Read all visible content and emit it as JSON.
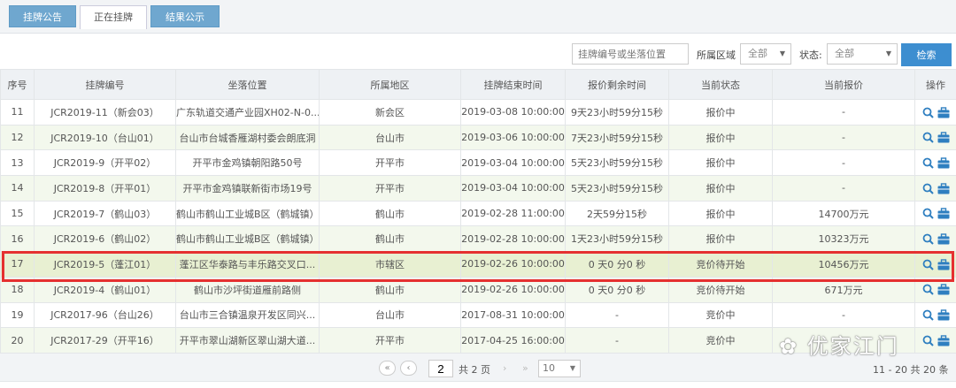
{
  "tabs": [
    "挂牌公告",
    "正在挂牌",
    "结果公示"
  ],
  "toolbar": {
    "search_placeholder": "挂牌编号或坐落位置",
    "region_label": "所属区域",
    "region_value": "全部",
    "status_label": "状态:",
    "status_value": "全部",
    "search_button": "检索"
  },
  "columns": [
    "序号",
    "挂牌编号",
    "坐落位置",
    "所属地区",
    "挂牌结束时间",
    "报价剩余时间",
    "当前状态",
    "当前报价",
    "操作"
  ],
  "rows": [
    [
      "11",
      "JCR2019-11（新会03）",
      "广东轨道交通产业园XH02-N-0...",
      "新会区",
      "2019-03-08 10:00:00",
      "9天23小时59分15秒",
      "报价中",
      "-"
    ],
    [
      "12",
      "JCR2019-10（台山01）",
      "台山市台城香雁湖村委会朗底洞",
      "台山市",
      "2019-03-06 10:00:00",
      "7天23小时59分15秒",
      "报价中",
      "-"
    ],
    [
      "13",
      "JCR2019-9（开平02）",
      "开平市金鸡镇朝阳路50号",
      "开平市",
      "2019-03-04 10:00:00",
      "5天23小时59分15秒",
      "报价中",
      "-"
    ],
    [
      "14",
      "JCR2019-8（开平01）",
      "开平市金鸡镇联新街市场19号",
      "开平市",
      "2019-03-04 10:00:00",
      "5天23小时59分15秒",
      "报价中",
      "-"
    ],
    [
      "15",
      "JCR2019-7（鹤山03）",
      "鹤山市鹤山工业城B区（鹤城镇）",
      "鹤山市",
      "2019-02-28 11:00:00",
      "2天59分15秒",
      "报价中",
      "14700万元"
    ],
    [
      "16",
      "JCR2019-6（鹤山02）",
      "鹤山市鹤山工业城B区（鹤城镇）",
      "鹤山市",
      "2019-02-28 10:00:00",
      "1天23小时59分15秒",
      "报价中",
      "10323万元"
    ],
    [
      "17",
      "JCR2019-5（蓬江01）",
      "蓬江区华泰路与丰乐路交叉口...",
      "市辖区",
      "2019-02-26 10:00:00",
      "0 天0 分0 秒",
      "竞价待开始",
      "10456万元"
    ],
    [
      "18",
      "JCR2019-4（鹤山01）",
      "鹤山市沙坪街道雁前路侧",
      "鹤山市",
      "2019-02-26 10:00:00",
      "0 天0 分0 秒",
      "竞价待开始",
      "671万元"
    ],
    [
      "19",
      "JCR2017-96（台山26）",
      "台山市三合镇温泉开发区同兴...",
      "台山市",
      "2017-08-31 10:00:00",
      "-",
      "竞价中",
      "-"
    ],
    [
      "20",
      "JCR2017-29（开平16）",
      "开平市翠山湖新区翠山湖大道...",
      "开平市",
      "2017-04-25 16:00:00",
      "-",
      "竞价中",
      "-"
    ]
  ],
  "highlighted_row": "17",
  "pager": {
    "page": "2",
    "total_pages": "共 2 页",
    "page_size": "10",
    "summary": "11 - 20  共 20 条"
  },
  "watermark": "优家江门",
  "colors": {
    "accent": "#3d8ed0",
    "highlight_border": "#e53030"
  }
}
